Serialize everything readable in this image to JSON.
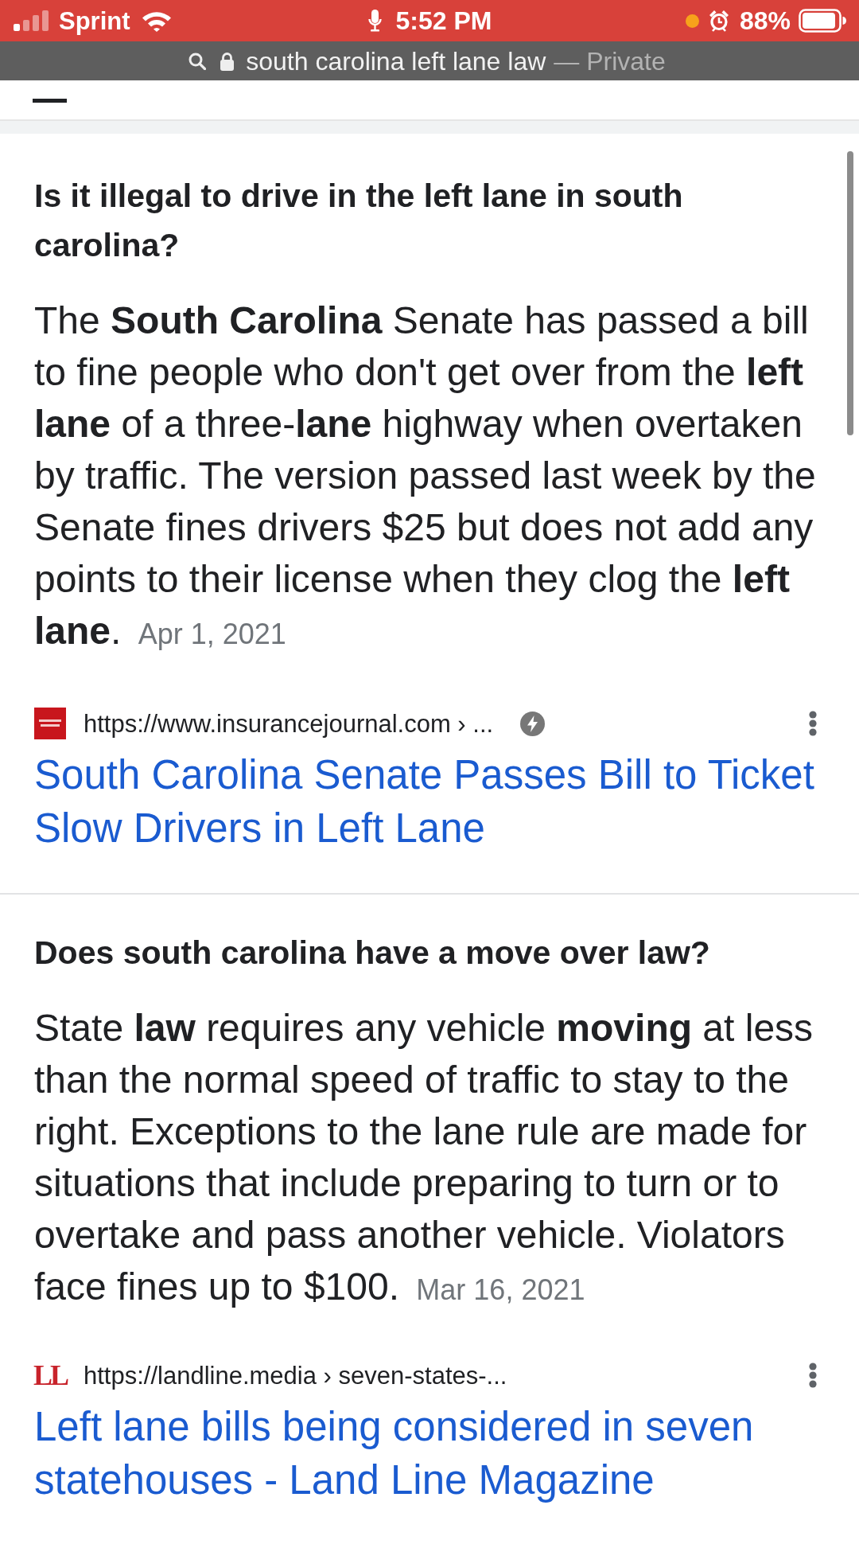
{
  "status_bar": {
    "carrier": "Sprint",
    "time": "5:52 PM",
    "battery": "88%"
  },
  "address_bar": {
    "query": "south carolina left lane law",
    "suffix": "— Private"
  },
  "results": [
    {
      "question": "Is it illegal to drive in the left lane in south carolina?",
      "answer": "The **South Carolina** Senate has passed a bill to fine people who don't get over from the **left lane** of a three-**lane** highway when overtaken by traffic. The version passed last week by the Senate fines drivers $25 but does not add any points to their license when they clog the **left lane**.",
      "date": "Apr 1, 2021",
      "source": {
        "logo": {
          "kind": "tile"
        },
        "url": "https://www.insurancejournal.com › ...",
        "fast_badge": true,
        "title": "South Carolina Senate Passes Bill to Ticket Slow Drivers in Left Lane"
      }
    },
    {
      "question": "Does south carolina have a move over law?",
      "answer": "State **law** requires any vehicle **moving** at less than the normal speed of traffic to stay to the right. Exceptions to the lane rule are made for situations that include preparing to turn or to overtake and pass another vehicle. Violators face fines up to $100.",
      "date": "Mar 16, 2021",
      "source": {
        "logo": {
          "kind": "letters",
          "text": "LL"
        },
        "url": "https://landline.media › seven-states-...",
        "fast_badge": false,
        "title": "Left lane bills being considered in seven statehouses - Land Line Magazine"
      }
    }
  ]
}
